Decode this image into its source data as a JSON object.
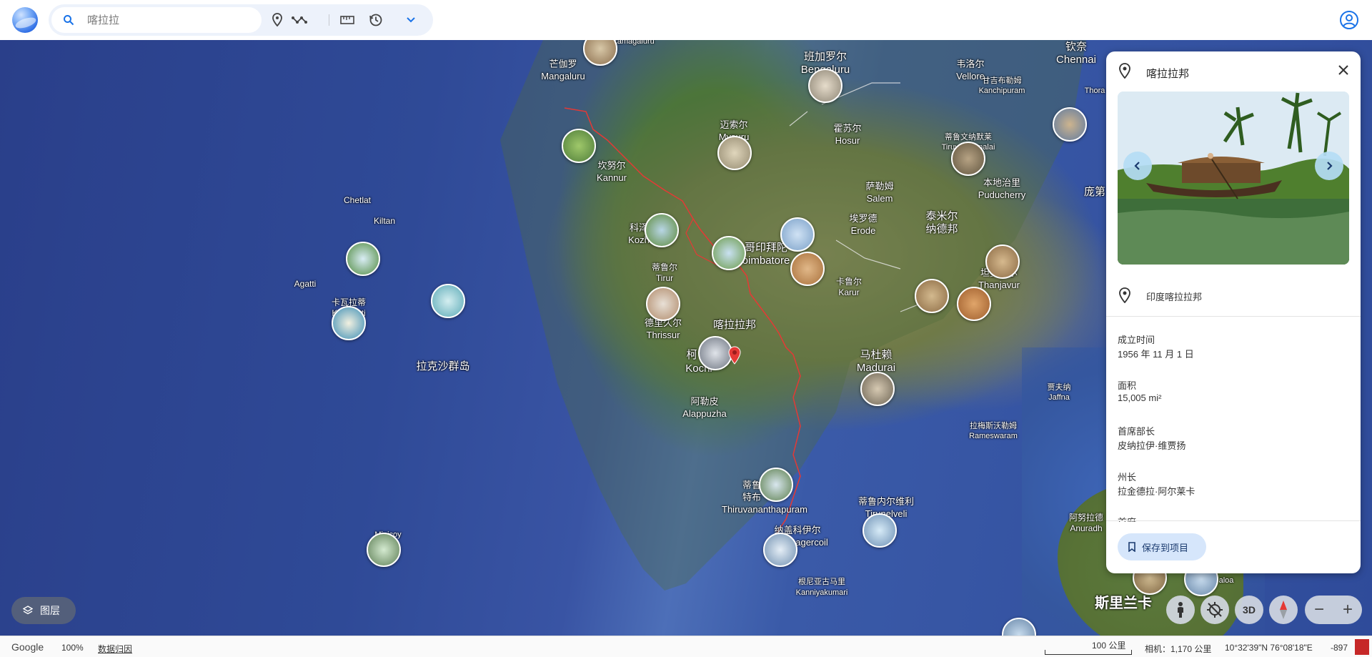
{
  "search": {
    "placeholder": "喀拉拉"
  },
  "map": {
    "labels": [
      {
        "name": "label-chikkamagaluru",
        "text": "Chikkamagaluru",
        "size": "small"
      },
      {
        "name": "label-mangaluru-cn",
        "text": "芒伽罗",
        "size": "normal"
      },
      {
        "name": "label-mangaluru",
        "text": "Mangaluru",
        "size": "normal"
      },
      {
        "name": "label-bengaluru-cn",
        "text": "班加罗尔",
        "size": "big"
      },
      {
        "name": "label-bengaluru",
        "text": "Bengaluru",
        "size": "big"
      },
      {
        "name": "label-vellore-cn",
        "text": "韦洛尔",
        "size": "normal"
      },
      {
        "name": "label-vellore",
        "text": "Vellore",
        "size": "normal"
      },
      {
        "name": "label-chennai-cn",
        "text": "钦奈",
        "size": "big"
      },
      {
        "name": "label-chennai",
        "text": "Chennai",
        "size": "big"
      },
      {
        "name": "label-kanchipuram-cn",
        "text": "甘吉布勒姆",
        "size": "small"
      },
      {
        "name": "label-kanchipuram",
        "text": "Kanchipuram",
        "size": "small"
      },
      {
        "name": "label-thora",
        "text": "Thora",
        "size": "small"
      },
      {
        "name": "label-mysuru-cn",
        "text": "迈索尔",
        "size": "normal"
      },
      {
        "name": "label-mysuru",
        "text": "Mysuru",
        "size": "normal"
      },
      {
        "name": "label-hosur-cn",
        "text": "霍苏尔",
        "size": "normal"
      },
      {
        "name": "label-hosur",
        "text": "Hosur",
        "size": "normal"
      },
      {
        "name": "label-tiruvannamalai-cn",
        "text": "蒂鲁文纳默莱",
        "size": "small"
      },
      {
        "name": "label-tiruvannamalai",
        "text": "Tiruvannamalai",
        "size": "small"
      },
      {
        "name": "label-puducherry-cn",
        "text": "本地治里",
        "size": "normal"
      },
      {
        "name": "label-puducherry",
        "text": "Puducherry",
        "size": "normal"
      },
      {
        "name": "label-pondicherry-cn",
        "text": "庞第",
        "size": "big"
      },
      {
        "name": "label-kannur-cn",
        "text": "坎努尔",
        "size": "normal"
      },
      {
        "name": "label-kannur",
        "text": "Kannur",
        "size": "normal"
      },
      {
        "name": "label-salem-cn",
        "text": "萨勒姆",
        "size": "normal"
      },
      {
        "name": "label-salem",
        "text": "Salem",
        "size": "normal"
      },
      {
        "name": "label-chetlat",
        "text": "Chetlat",
        "size": "small"
      },
      {
        "name": "label-kiltan",
        "text": "Kiltan",
        "size": "small"
      },
      {
        "name": "label-erode-cn",
        "text": "埃罗德",
        "size": "normal"
      },
      {
        "name": "label-erode",
        "text": "Erode",
        "size": "normal"
      },
      {
        "name": "label-tamil-nadu-cn",
        "text": "泰米尔",
        "size": "big"
      },
      {
        "name": "label-tamil-nadu-cn2",
        "text": "纳德邦",
        "size": "big"
      },
      {
        "name": "label-kozhikode-cn",
        "text": "科泽",
        "size": "normal"
      },
      {
        "name": "label-kozhikode",
        "text": "Kozh",
        "size": "normal"
      },
      {
        "name": "label-coimbatore-cn",
        "text": "哥印拜陀",
        "size": "big"
      },
      {
        "name": "label-coimbatore",
        "text": "oimbatore",
        "size": "big"
      },
      {
        "name": "label-agatti",
        "text": "Agatti",
        "size": "small"
      },
      {
        "name": "label-tirur-cn",
        "text": "蒂鲁尔",
        "size": "small"
      },
      {
        "name": "label-tirur",
        "text": "Tirur",
        "size": "small"
      },
      {
        "name": "label-thanjavur-cn",
        "text": "坦贾武尔",
        "size": "normal"
      },
      {
        "name": "label-thanjavur",
        "text": "Thanjavur",
        "size": "normal"
      },
      {
        "name": "label-karur-cn",
        "text": "卡鲁尔",
        "size": "small"
      },
      {
        "name": "label-karur",
        "text": "Karur",
        "size": "small"
      },
      {
        "name": "label-kavaratti-cn",
        "text": "卡瓦拉蒂",
        "size": "small"
      },
      {
        "name": "label-kavaratti",
        "text": "Kavaratti",
        "size": "small"
      },
      {
        "name": "label-thrissur-cn",
        "text": "德里久尔",
        "size": "normal"
      },
      {
        "name": "label-thrissur",
        "text": "Thrissur",
        "size": "normal"
      },
      {
        "name": "label-kerala-cn",
        "text": "喀拉拉邦",
        "size": "big"
      },
      {
        "name": "label-lakshadweep-cn",
        "text": "拉克沙群岛",
        "size": "big"
      },
      {
        "name": "label-kochi-cn",
        "text": "柯",
        "size": "big"
      },
      {
        "name": "label-kochi",
        "text": "Kochi",
        "size": "big"
      },
      {
        "name": "label-madurai-cn",
        "text": "马杜赖",
        "size": "big"
      },
      {
        "name": "label-madurai",
        "text": "Madurai",
        "size": "big"
      },
      {
        "name": "label-alappuzha-cn",
        "text": "阿勒皮",
        "size": "normal"
      },
      {
        "name": "label-alappuzha",
        "text": "Alappuzha",
        "size": "normal"
      },
      {
        "name": "label-jaffna-cn",
        "text": "贾夫纳",
        "size": "small"
      },
      {
        "name": "label-jaffna",
        "text": "Jaffna",
        "size": "small"
      },
      {
        "name": "label-rameswaram-cn",
        "text": "拉梅斯沃勒姆",
        "size": "small"
      },
      {
        "name": "label-rameswaram",
        "text": "Rameswaram",
        "size": "small"
      },
      {
        "name": "label-thiruvananthapuram-cn",
        "text": "蒂鲁",
        "size": "normal"
      },
      {
        "name": "label-thiruvananthapuram-cn2",
        "text": "特布",
        "size": "normal"
      },
      {
        "name": "label-thiruvananthapuram",
        "text": "Thiruvananthapuram",
        "size": "normal"
      },
      {
        "name": "label-tirunelveli-cn",
        "text": "蒂鲁内尔维利",
        "size": "normal"
      },
      {
        "name": "label-tirunelveli",
        "text": "Tirunelveli",
        "size": "normal"
      },
      {
        "name": "label-anuradhapura-cn",
        "text": "阿努拉德",
        "size": "small"
      },
      {
        "name": "label-anuradhapura",
        "text": "Anuradh",
        "size": "small"
      },
      {
        "name": "label-minicoy",
        "text": "Minicoy",
        "size": "small"
      },
      {
        "name": "label-nagercoil-cn",
        "text": "纳盖科伊尔",
        "size": "normal"
      },
      {
        "name": "label-nagercoil",
        "text": "agercoil",
        "size": "normal"
      },
      {
        "name": "label-kanniyakumari-cn",
        "text": "根尼亚古马里",
        "size": "small"
      },
      {
        "name": "label-kanniyakumari",
        "text": "Kanniyakumari",
        "size": "small"
      },
      {
        "name": "label-sri-lanka-cn",
        "text": "斯里兰卡",
        "size": "huge"
      },
      {
        "name": "label-aloa",
        "text": "aloa",
        "size": "small"
      }
    ]
  },
  "controls": {
    "layers_label": "图层",
    "three_d_label": "3D",
    "zoom_out_label": "−",
    "zoom_in_label": "+"
  },
  "status": {
    "brand": "Google",
    "zoom": "100%",
    "data_attribution": "数据归因",
    "scale": "100 公里",
    "camera": "相机：1,170 公里",
    "coords": "10°32'39\"N 76°08'18\"E",
    "elevation": "-897"
  },
  "panel": {
    "title": "喀拉拉邦",
    "address": "印度喀拉拉邦",
    "facts": [
      {
        "label": "成立时间",
        "value": "1956 年 11 月 1 日"
      },
      {
        "label": "面积",
        "value": "15,005 mi²"
      },
      {
        "label": "首席部长",
        "value": "皮纳拉伊·维贾扬"
      },
      {
        "label": "州长",
        "value": "拉金德拉·阿尔莱卡"
      }
    ],
    "partial_label": "首府",
    "save_label": "保存到项目"
  },
  "colors": {
    "accent": "#1a73e8",
    "state_border": "#e53935",
    "save_bg": "#d6e6fb",
    "pin": "#e53935"
  }
}
